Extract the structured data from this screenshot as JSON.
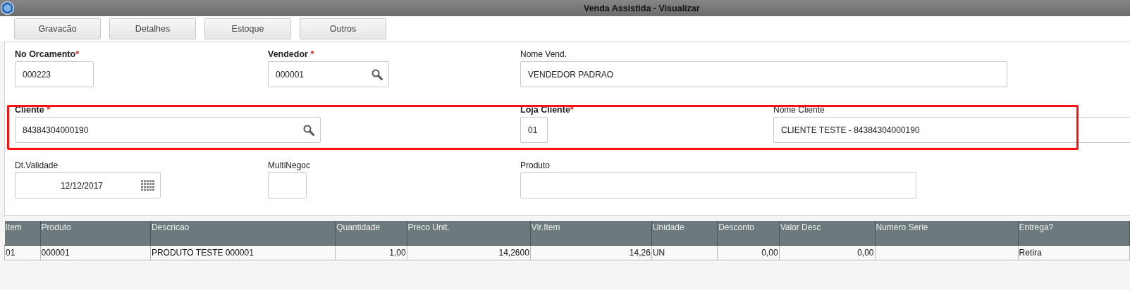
{
  "window": {
    "title": "Venda Assistida - Visualizar"
  },
  "buttons": [
    "Gravacão",
    "Detalhes",
    "Estoque",
    "Outros"
  ],
  "form_rows": [
    {
      "highlighted": false,
      "fields": [
        {
          "label": "No Orcamento",
          "required_mark": "*",
          "value": "000223",
          "kind": "text"
        },
        {
          "label": "Vendedor",
          "required_mark": " *",
          "value": "000001",
          "kind": "lookup"
        },
        {
          "label": "Nome Vend.",
          "value": "VENDEDOR PADRAO",
          "kind": "text"
        }
      ]
    },
    {
      "highlighted": true,
      "fields": [
        {
          "label": "Cliente",
          "required_mark": " *",
          "value": "84384304000190",
          "kind": "lookup"
        },
        {
          "label": "Loja Cliente",
          "required_mark": "*",
          "value": "01",
          "kind": "text"
        },
        {
          "label": "Nome Cliente",
          "value": "CLIENTE TESTE - 84384304000190",
          "kind": "text"
        }
      ]
    },
    {
      "highlighted": false,
      "fields": [
        {
          "label": "Dt.Validade",
          "value": "12/12/2017",
          "kind": "date"
        },
        {
          "label": "MultiNegoc",
          "kind": "text"
        },
        {
          "label": "Produto",
          "kind": "text"
        }
      ]
    }
  ],
  "table": {
    "columns": [
      "Item",
      "Produto",
      "Descricao",
      "Quantidade",
      "Preco Unit.",
      "Vlr.Item",
      "Unidade",
      "Desconto",
      "Valor Desc",
      "Numero Serie",
      "Entrega?"
    ],
    "rows": [
      [
        "01",
        "000001",
        "PRODUTO TESTE 000001",
        "1,00",
        "14,2600",
        "14,26",
        "UN",
        "0,00",
        "0,00",
        "",
        "Retira"
      ]
    ]
  }
}
